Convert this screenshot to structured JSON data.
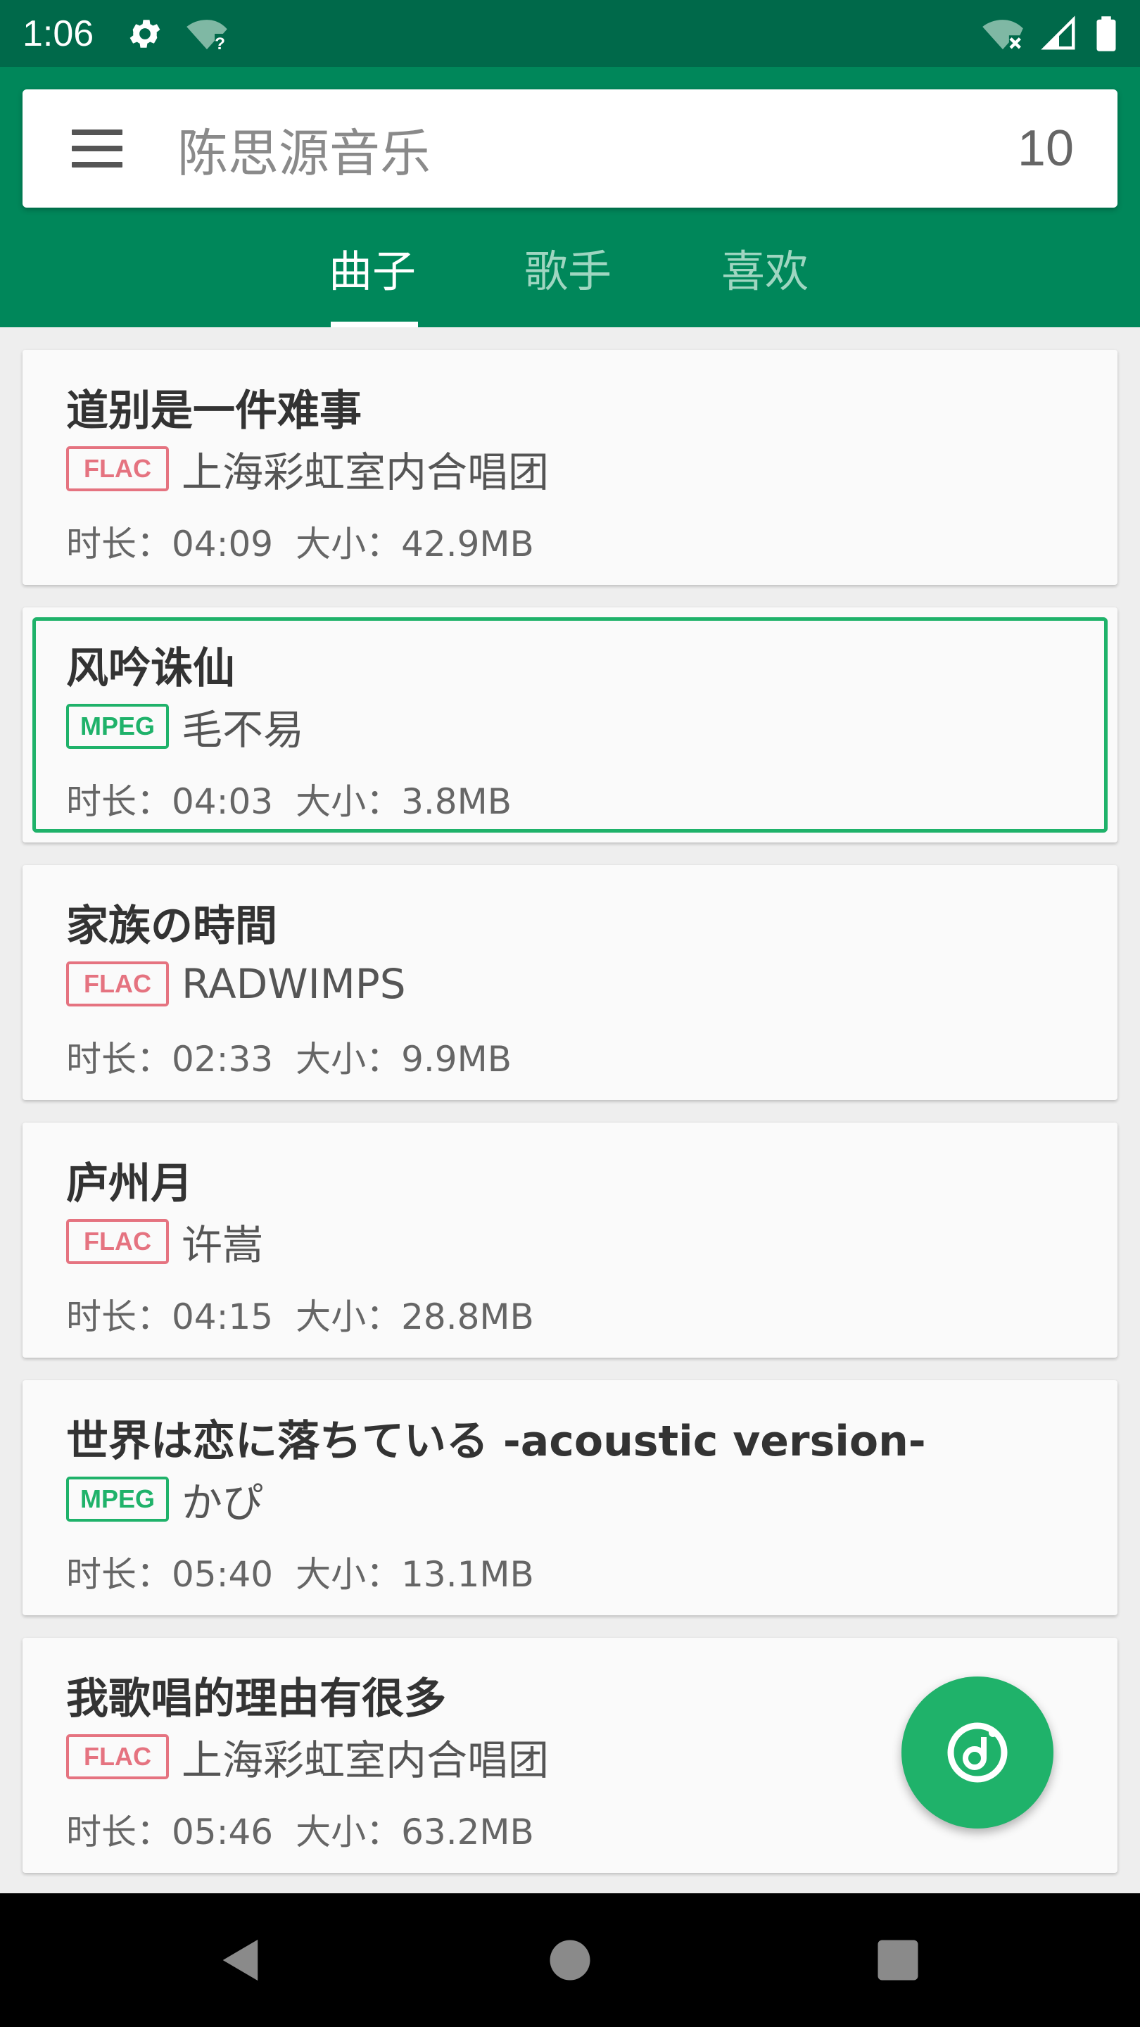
{
  "status_bar": {
    "time": "1:06",
    "icons": [
      "settings-icon",
      "wifi-question-icon",
      "wifi-x-icon",
      "signal-icon",
      "battery-icon"
    ]
  },
  "app_bar": {
    "title": "陈思源音乐",
    "count": "10",
    "tabs": [
      {
        "label": "曲子",
        "active": true
      },
      {
        "label": "歌手",
        "active": false
      },
      {
        "label": "喜欢",
        "active": false
      }
    ]
  },
  "songs": [
    {
      "title": "道别是一件难事",
      "format": "FLAC",
      "artist": "上海彩虹室内合唱团",
      "duration": "时长：04:09",
      "size": "大小：42.9MB",
      "selected": false
    },
    {
      "title": "风吟诛仙",
      "format": "MPEG",
      "artist": "毛不易",
      "duration": "时长：04:03",
      "size": "大小：3.8MB",
      "selected": true
    },
    {
      "title": "家族の時間",
      "format": "FLAC",
      "artist": "RADWIMPS",
      "duration": "时长：02:33",
      "size": "大小：9.9MB",
      "selected": false
    },
    {
      "title": "庐州月",
      "format": "FLAC",
      "artist": "许嵩",
      "duration": "时长：04:15",
      "size": "大小：28.8MB",
      "selected": false
    },
    {
      "title": "世界は恋に落ちている -acoustic version-",
      "format": "MPEG",
      "artist": "かぴ",
      "duration": "时长：05:40",
      "size": "大小：13.1MB",
      "selected": false
    },
    {
      "title": "我歌唱的理由有很多",
      "format": "FLAC",
      "artist": "上海彩虹室内合唱团",
      "duration": "时长：05:46",
      "size": "大小：63.2MB",
      "selected": false
    }
  ],
  "colors": {
    "status_bar": "#00694a",
    "app_bar": "#00875a",
    "accent": "#1fb26a",
    "flac": "#e57380"
  },
  "fab": {
    "icon": "music-note-icon"
  },
  "nav": {
    "icons": [
      "back-icon",
      "home-icon",
      "recents-icon"
    ]
  }
}
